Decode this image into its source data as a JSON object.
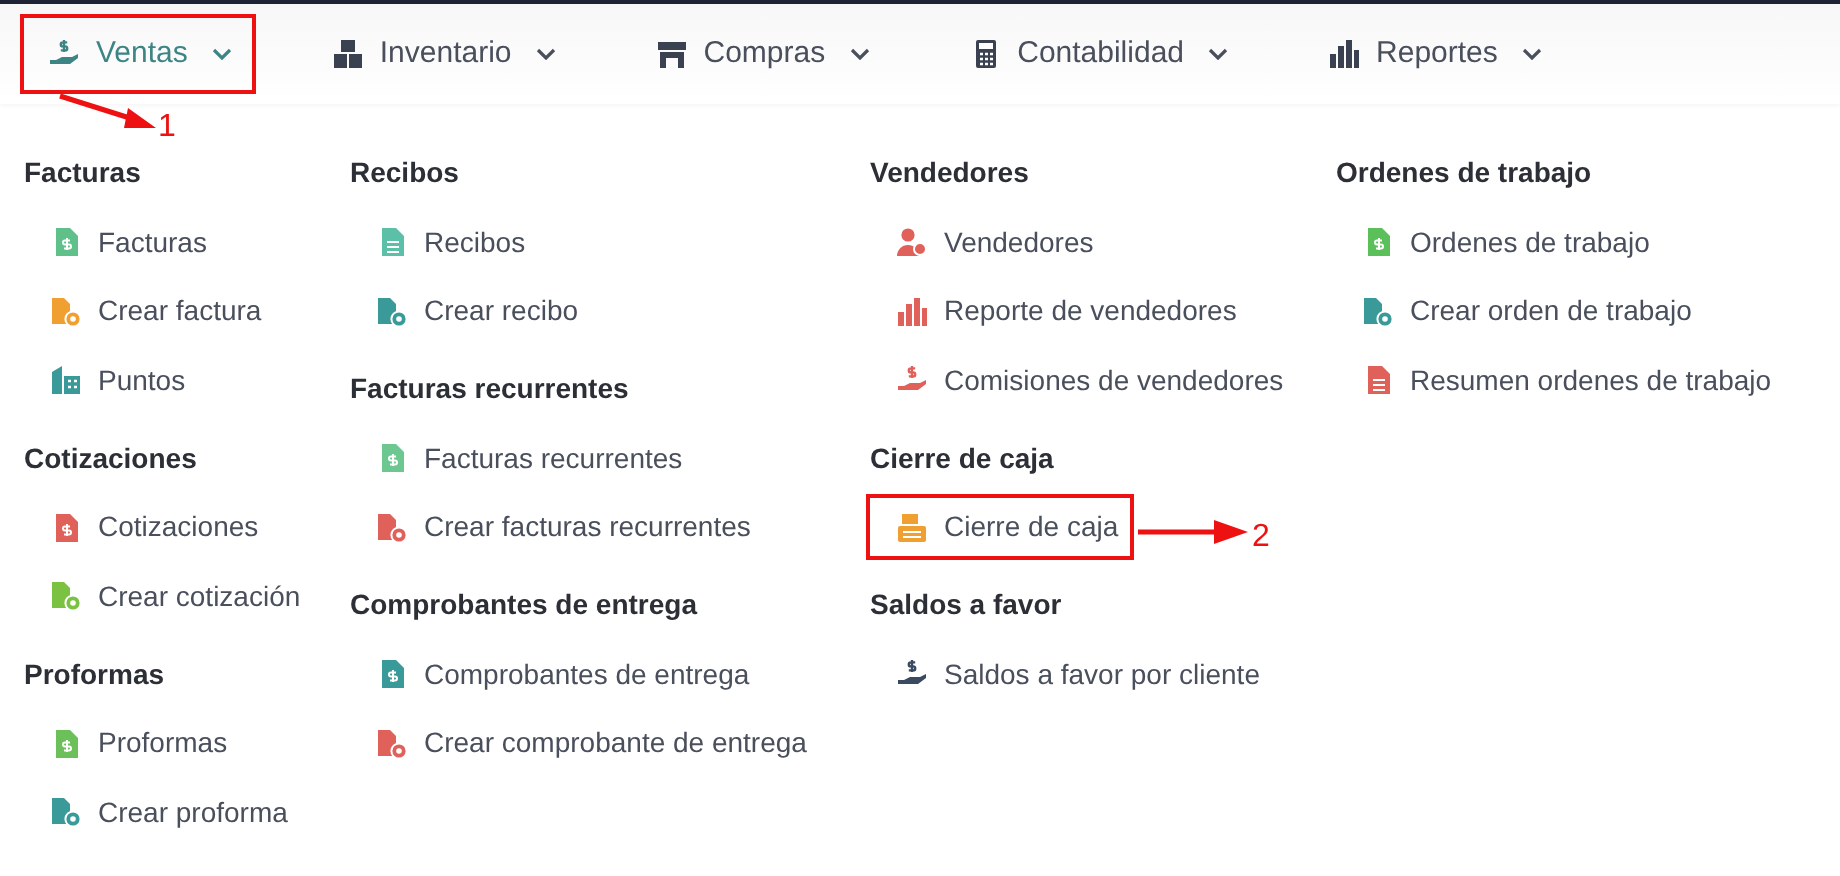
{
  "nav": [
    {
      "label": "Ventas",
      "kind": "hand-coin",
      "selected": true,
      "highlighted": true
    },
    {
      "label": "Inventario",
      "kind": "boxes",
      "selected": false,
      "highlighted": false
    },
    {
      "label": "Compras",
      "kind": "store",
      "selected": false,
      "highlighted": false
    },
    {
      "label": "Contabilidad",
      "kind": "calculator",
      "selected": false,
      "highlighted": false
    },
    {
      "label": "Reportes",
      "kind": "bars",
      "selected": false,
      "highlighted": false
    }
  ],
  "columns": [
    {
      "sections": [
        {
          "title": "Facturas",
          "items": [
            {
              "label": "Facturas",
              "kind": "doc-dollar",
              "color": "#5fc08a",
              "highlighted": false
            },
            {
              "label": "Crear factura",
              "kind": "doc-add",
              "color": "#f0a030",
              "highlighted": false
            },
            {
              "label": "Puntos",
              "kind": "buildings",
              "color": "#3a9a9a",
              "highlighted": false
            }
          ]
        },
        {
          "title": "Cotizaciones",
          "items": [
            {
              "label": "Cotizaciones",
              "kind": "doc-dollar",
              "color": "#e0605a",
              "highlighted": false
            },
            {
              "label": "Crear cotización",
              "kind": "doc-add",
              "color": "#7cc242",
              "highlighted": false
            }
          ]
        },
        {
          "title": "Proformas",
          "items": [
            {
              "label": "Proformas",
              "kind": "doc-dollar",
              "color": "#6cc05a",
              "highlighted": false
            },
            {
              "label": "Crear proforma",
              "kind": "doc-add",
              "color": "#3a9a9a",
              "highlighted": false
            }
          ]
        }
      ]
    },
    {
      "sections": [
        {
          "title": "Recibos",
          "items": [
            {
              "label": "Recibos",
              "kind": "doc-lines",
              "color": "#5cc0a8",
              "highlighted": false
            },
            {
              "label": "Crear recibo",
              "kind": "doc-add",
              "color": "#3a9a9a",
              "highlighted": false
            }
          ]
        },
        {
          "title": "Facturas recurrentes",
          "items": [
            {
              "label": "Facturas recurrentes",
              "kind": "doc-dollar",
              "color": "#6cc890",
              "highlighted": false
            },
            {
              "label": "Crear facturas recurrentes",
              "kind": "doc-add",
              "color": "#e0605a",
              "highlighted": false
            }
          ]
        },
        {
          "title": "Comprobantes de entrega",
          "items": [
            {
              "label": "Comprobantes de entrega",
              "kind": "doc-dollar",
              "color": "#3a9a9a",
              "highlighted": false
            },
            {
              "label": "Crear comprobante de entrega",
              "kind": "doc-add",
              "color": "#e0605a",
              "highlighted": false
            }
          ]
        }
      ]
    },
    {
      "sections": [
        {
          "title": "Vendedores",
          "items": [
            {
              "label": "Vendedores",
              "kind": "user",
              "color": "#e0605a",
              "highlighted": false
            },
            {
              "label": "Reporte de vendedores",
              "kind": "bars",
              "color": "#e0605a",
              "highlighted": false
            },
            {
              "label": "Comisiones de vendedores",
              "kind": "hand-coin",
              "color": "#e0605a",
              "highlighted": false
            }
          ]
        },
        {
          "title": "Cierre de caja",
          "items": [
            {
              "label": "Cierre de caja",
              "kind": "register",
              "color": "#f0a030",
              "highlighted": true
            }
          ]
        },
        {
          "title": "Saldos a favor",
          "items": [
            {
              "label": "Saldos a favor por cliente",
              "kind": "hand-coin",
              "color": "#3a4a60",
              "highlighted": false
            }
          ]
        }
      ]
    },
    {
      "sections": [
        {
          "title": "Ordenes de trabajo",
          "items": [
            {
              "label": "Ordenes de trabajo",
              "kind": "doc-dollar",
              "color": "#5cc05a",
              "highlighted": false
            },
            {
              "label": "Crear orden de trabajo",
              "kind": "doc-add",
              "color": "#3a9a9a",
              "highlighted": false
            },
            {
              "label": "Resumen ordenes de trabajo",
              "kind": "doc-lines",
              "color": "#e0605a",
              "highlighted": false
            }
          ]
        }
      ]
    }
  ],
  "annotations": [
    "1",
    "2"
  ]
}
